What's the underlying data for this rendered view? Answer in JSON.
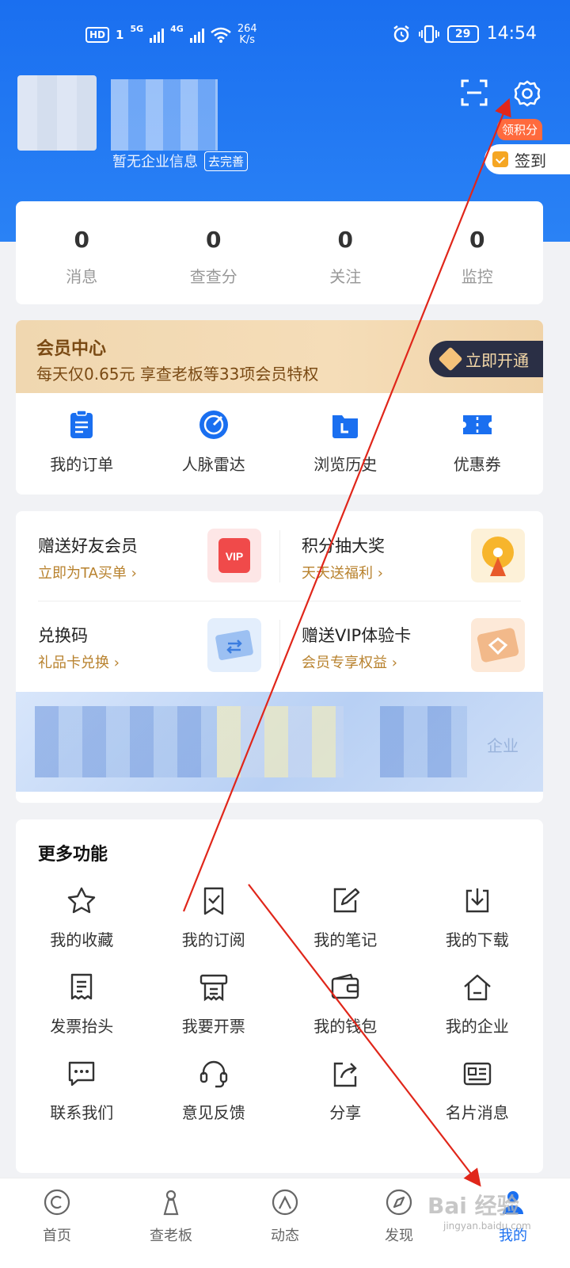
{
  "status_bar": {
    "hd": "HD",
    "sim": "1",
    "net1": "5G",
    "net2": "4G",
    "speed_value": "264",
    "speed_unit": "K/s",
    "battery": "29",
    "time": "14:54"
  },
  "profile": {
    "subline": "暂无企业信息",
    "complete_button": "去完善",
    "points_tag": "领积分",
    "checkin_label": "签到"
  },
  "stats": [
    {
      "value": "0",
      "label": "消息"
    },
    {
      "value": "0",
      "label": "查查分"
    },
    {
      "value": "0",
      "label": "关注"
    },
    {
      "value": "0",
      "label": "监控"
    }
  ],
  "vip": {
    "title": "会员中心",
    "desc": "每天仅0.65元  享查老板等33项会员特权",
    "button": "立即开通"
  },
  "quick_actions": [
    {
      "label": "我的订单",
      "icon": "order-icon"
    },
    {
      "label": "人脉雷达",
      "icon": "radar-icon"
    },
    {
      "label": "浏览历史",
      "icon": "history-icon"
    },
    {
      "label": "优惠券",
      "icon": "coupon-icon"
    }
  ],
  "promos": [
    {
      "title": "赠送好友会员",
      "sub": "立即为TA买单 ›",
      "icon": "vip-gift-icon"
    },
    {
      "title": "积分抽大奖",
      "sub": "天天送福利 ›",
      "icon": "prize-wheel-icon"
    },
    {
      "title": "兑换码",
      "sub": "礼品卡兑换 ›",
      "icon": "ticket-icon"
    },
    {
      "title": "赠送VIP体验卡",
      "sub": "会员专享权益 ›",
      "icon": "vip-card-icon"
    }
  ],
  "banner": {
    "text": "企业"
  },
  "more": {
    "title": "更多功能",
    "items": [
      {
        "label": "我的收藏",
        "icon": "star-icon"
      },
      {
        "label": "我的订阅",
        "icon": "subscribe-icon"
      },
      {
        "label": "我的笔记",
        "icon": "note-icon"
      },
      {
        "label": "我的下载",
        "icon": "download-icon"
      },
      {
        "label": "发票抬头",
        "icon": "invoice-title-icon"
      },
      {
        "label": "我要开票",
        "icon": "invoice-icon"
      },
      {
        "label": "我的钱包",
        "icon": "wallet-icon"
      },
      {
        "label": "我的企业",
        "icon": "company-icon"
      },
      {
        "label": "联系我们",
        "icon": "chat-icon"
      },
      {
        "label": "意见反馈",
        "icon": "headset-icon"
      },
      {
        "label": "分享",
        "icon": "share-icon"
      },
      {
        "label": "名片消息",
        "icon": "card-icon"
      }
    ]
  },
  "tabs": [
    {
      "label": "首页",
      "icon": "home-icon"
    },
    {
      "label": "查老板",
      "icon": "boss-icon"
    },
    {
      "label": "动态",
      "icon": "feed-icon"
    },
    {
      "label": "发现",
      "icon": "compass-icon"
    },
    {
      "label": "我的",
      "icon": "profile-icon"
    }
  ],
  "watermark": {
    "main": "Bai 经验",
    "sub": "jingyan.baidu.com"
  },
  "colors": {
    "brand": "#1a6ff0",
    "vip_gold": "#b8822e",
    "annotation": "#e0261a"
  }
}
